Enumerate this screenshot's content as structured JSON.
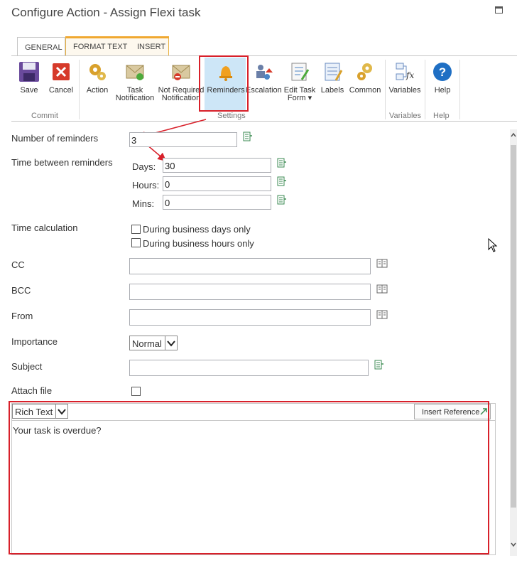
{
  "window": {
    "title": "Configure Action - Assign Flexi task"
  },
  "ribbon": {
    "tabs": {
      "general": "GENERAL",
      "format_text": "FORMAT TEXT",
      "insert": "INSERT"
    },
    "buttons": {
      "save": "Save",
      "cancel": "Cancel",
      "action": "Action",
      "task_notification_1": "Task",
      "task_notification_2": "Notification",
      "not_required_1": "Not Required",
      "not_required_2": "Notification",
      "reminders": "Reminders",
      "escalation": "Escalation",
      "edit_task_form_1": "Edit Task",
      "edit_task_form_2": "Form",
      "labels": "Labels",
      "common": "Common",
      "variables": "Variables",
      "help": "Help"
    },
    "groups": {
      "commit": "Commit",
      "settings": "Settings",
      "variables": "Variables",
      "help": "Help"
    }
  },
  "form": {
    "number_of_reminders": {
      "label": "Number of reminders",
      "value": "3"
    },
    "time_between": {
      "label": "Time between reminders",
      "days_label": "Days:",
      "days": "30",
      "hours_label": "Hours:",
      "hours": "0",
      "mins_label": "Mins:",
      "mins": "0"
    },
    "time_calc": {
      "label": "Time calculation",
      "opt1": "During business days only",
      "opt2": "During business hours only"
    },
    "cc": {
      "label": "CC",
      "value": ""
    },
    "bcc": {
      "label": "BCC",
      "value": ""
    },
    "from": {
      "label": "From",
      "value": ""
    },
    "importance": {
      "label": "Importance",
      "value": "Normal"
    },
    "subject": {
      "label": "Subject",
      "value": ""
    },
    "attach": {
      "label": "Attach file"
    },
    "body": {
      "format": "Rich Text",
      "insert_reference": "Insert Reference",
      "text": "Your task is overdue?"
    }
  },
  "colors": {
    "highlight": "#d8202a",
    "selected": "#cde6f7",
    "tab_accent": "#f0a830"
  }
}
